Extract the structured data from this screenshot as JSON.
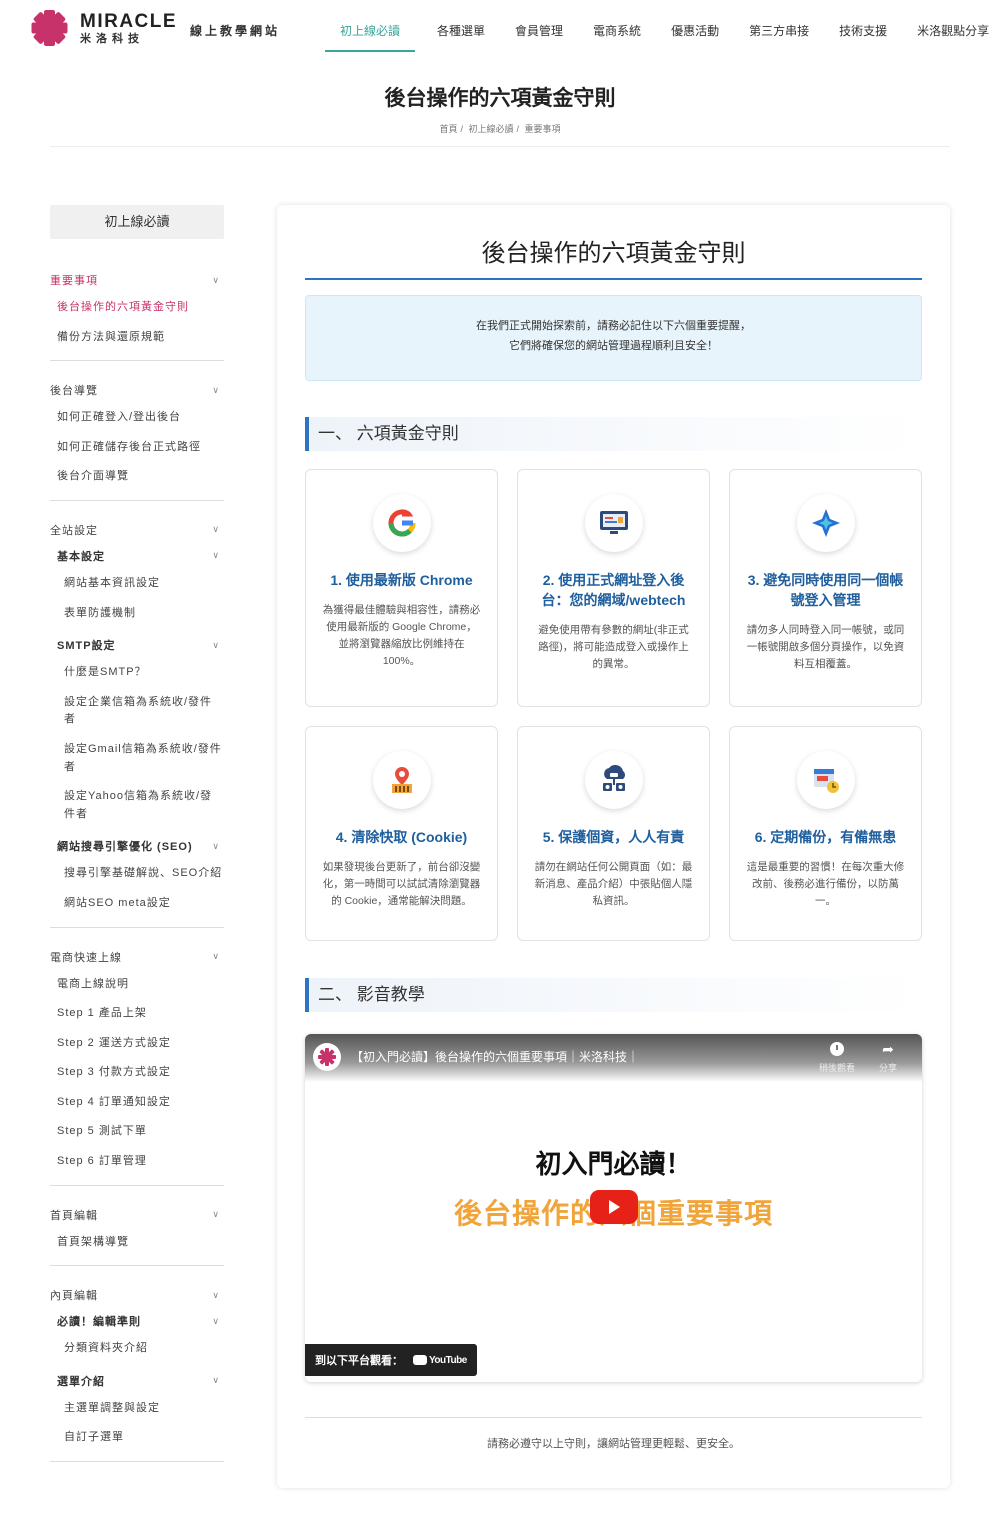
{
  "header": {
    "logo_en": "MIRACLE",
    "logo_zh": "米洛科技",
    "site_name": "線上教學網站",
    "nav": [
      "初上線必讀",
      "各種選單",
      "會員管理",
      "電商系統",
      "優惠活動",
      "第三方串接",
      "技術支援",
      "米洛觀點分享"
    ],
    "active_nav": 0,
    "accent": "#3aa69b"
  },
  "page": {
    "title": "後台操作的六項黃金守則",
    "breadcrumb": [
      "首頁",
      "初上線必讀",
      "重要事項"
    ]
  },
  "sidebar": {
    "title": "初上線必讀",
    "sections": [
      {
        "label": "重要事項",
        "items": [
          "後台操作的六項黃金守則",
          "備份方法與還原規範"
        ]
      },
      {
        "label": "後台導覽",
        "items": [
          "如何正確登入/登出後台",
          "如何正確儲存後台正式路徑",
          "後台介面導覽"
        ]
      },
      {
        "label": "全站設定",
        "groups": [
          {
            "label": "基本設定",
            "items": [
              "網站基本資訊設定",
              "表單防護機制"
            ]
          },
          {
            "label": "SMTP設定",
            "items": [
              "什麼是SMTP？",
              "設定企業信箱為系統收/發件者",
              "設定Gmail信箱為系統收/發件者",
              "設定Yahoo信箱為系統收/發件者"
            ]
          },
          {
            "label": "網站搜尋引擎優化 (SEO)",
            "items": [
              "搜尋引擎基礎解說、SEO介紹",
              "網站SEO meta設定"
            ]
          }
        ]
      },
      {
        "label": "電商快速上線",
        "items": [
          "電商上線說明",
          "Step 1 產品上架",
          "Step 2 運送方式設定",
          "Step 3 付款方式設定",
          "Step 4 訂單通知設定",
          "Step 5 測試下單",
          "Step 6 訂單管理"
        ]
      },
      {
        "label": "首頁編輯",
        "items": [
          "首頁架構導覽"
        ]
      },
      {
        "label": "內頁編輯",
        "groups": [
          {
            "label": "必讀！編輯準則",
            "items": [
              "分類資料夾介紹"
            ]
          },
          {
            "label": "選單介紹",
            "items": [
              "主選單調整與設定",
              "自訂子選單"
            ]
          }
        ]
      }
    ]
  },
  "content": {
    "title": "後台操作的六項黃金守則",
    "notice_line1": "在我們正式開始探索前，請務必記住以下六個重要提醒，",
    "notice_line2": "它們將確保您的網站管理過程順利且安全！",
    "section1": "一、 六項黃金守則",
    "rules": [
      {
        "icon": "google-chrome-icon",
        "title": "1. 使用最新版 Chrome",
        "desc": "為獲得最佳體驗與相容性，請務必使用最新版的 Google Chrome，並將瀏覽器縮放比例維持在 100%。"
      },
      {
        "icon": "monitor-url-icon",
        "title": "2. 使用正式網址登入後台：您的網域/webtech",
        "desc": "避免使用帶有參數的網址(非正式路徑)，將可能造成登入或操作上的異常。"
      },
      {
        "icon": "sparkle-icon",
        "title": "3. 避免同時使用同一個帳號登入管理",
        "desc": "請勿多人同時登入同一帳號，或同一帳號開啟多個分頁操作，以免資料互相覆蓋。"
      },
      {
        "icon": "browser-cache-icon",
        "title": "4. 清除快取 (Cookie)",
        "desc": "如果發現後台更新了，前台卻沒變化，第一時間可以試試清除瀏覽器的 Cookie，通常能解決問題。"
      },
      {
        "icon": "privacy-cloud-icon",
        "title": "5. 保護個資，人人有責",
        "desc": "請勿在網站任何公開頁面（如：最新消息、產品介紹）中張貼個人隱私資訊。"
      },
      {
        "icon": "backup-calendar-icon",
        "title": "6. 定期備份，有備無患",
        "desc": "這是最重要的習慣！在每次重大修改前、後務必進行備份，以防萬一。"
      }
    ],
    "section2": "二、 影音教學",
    "video": {
      "title": "【初入門必讀】後台操作的六個重要事項｜米洛科技｜",
      "watch_later": "稍後觀看",
      "share": "分享",
      "big_line1": "初入門必讀！",
      "big_line2": "後台操作的六個重要事項",
      "watch_on": "到以下平台觀看：",
      "platform": "YouTube"
    },
    "footer": "請務必遵守以上守則，讓網站管理更輕鬆、更安全。"
  },
  "colors": {
    "brand": "#c8326a",
    "link_active": "#c8326a",
    "heading_blue": "#1f5f9e",
    "rule_blue": "#2d74c4",
    "notice_bg": "#e8f4fb"
  }
}
